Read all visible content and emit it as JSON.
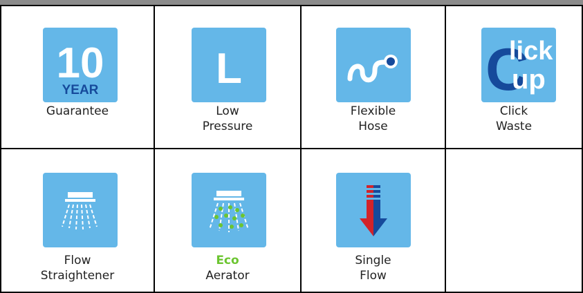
{
  "colors": {
    "tile_blue": "#64b7e8",
    "dark_blue": "#164a9b",
    "eco_green": "#6cc531",
    "flow_red": "#d2232a"
  },
  "grid": {
    "row1": [
      {
        "icon": "ten-year-icon",
        "tile_big": "10",
        "tile_small": "YEAR",
        "label_lines": [
          "Guarantee"
        ]
      },
      {
        "icon": "low-pressure-icon",
        "tile_big": "L",
        "label_lines": [
          "Low",
          "Pressure"
        ]
      },
      {
        "icon": "flexible-hose-icon",
        "label_lines": [
          "Flexible",
          "Hose"
        ]
      },
      {
        "icon": "click-up-icon",
        "tile_text_c": "C",
        "tile_text_lick": "lick",
        "tile_text_up": "up",
        "label_lines": [
          "Click",
          "Waste"
        ]
      }
    ],
    "row2": [
      {
        "icon": "flow-straightener-icon",
        "label_lines": [
          "Flow",
          "Straightener"
        ]
      },
      {
        "icon": "eco-aerator-icon",
        "label_eco": "Eco",
        "label_lines": [
          "Aerator"
        ]
      },
      {
        "icon": "single-flow-icon",
        "label_lines": [
          "Single",
          "Flow"
        ]
      }
    ]
  }
}
